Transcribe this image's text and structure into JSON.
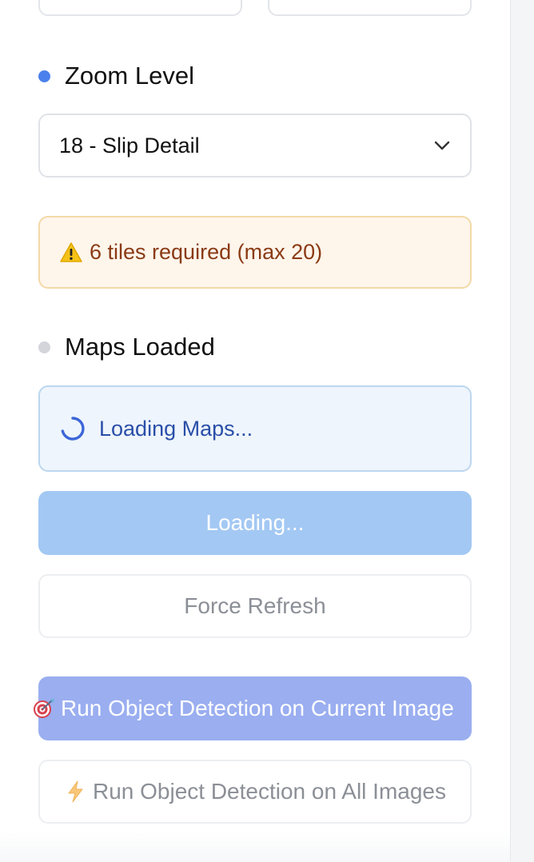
{
  "zoom_section": {
    "title": "Zoom Level",
    "dot_color": "#4a80ec",
    "selected_value": "18 - Slip Detail"
  },
  "warning": {
    "icon": "warning-triangle-icon",
    "text": "6 tiles required (max 20)"
  },
  "maps_section": {
    "title": "Maps Loaded",
    "dot_color": "#d3d5da",
    "status_text": "Loading Maps..."
  },
  "buttons": {
    "loading_label": "Loading...",
    "force_refresh_label": "Force Refresh",
    "detect_current_label": "Run Object Detection on Current Image",
    "detect_current_icon": "target-dart-icon",
    "detect_all_label": "Run Object Detection on All Images",
    "detect_all_icon": "lightning-icon"
  },
  "colors": {
    "warning_bg": "#fef5eb",
    "warning_border": "#f3d9a8",
    "warning_text": "#8a3a14",
    "loading_bg": "#eef5fc",
    "loading_text": "#2a4fa8",
    "primary_disabled": "#a3c8f3",
    "detect_button": "#9aaef0"
  }
}
